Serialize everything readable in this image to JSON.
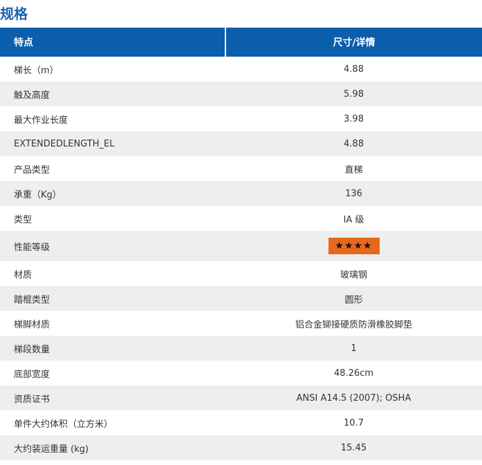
{
  "page": {
    "title": "规格"
  },
  "table": {
    "headers": [
      "特点",
      "尺寸/详情"
    ],
    "rows": [
      {
        "label": "梯长（m）",
        "value": "4.88"
      },
      {
        "label": "触及高度",
        "value": "5.98"
      },
      {
        "label": "最大作业长度",
        "value": "3.98"
      },
      {
        "label": "EXTENDEDLENGTH_EL",
        "value": "4.88"
      },
      {
        "label": "产品类型",
        "value": "直梯"
      },
      {
        "label": "承重（Kg）",
        "value": "136"
      },
      {
        "label": "类型",
        "value": "IA 级"
      },
      {
        "label": "性能等级",
        "value": "★★★★",
        "rating": 4
      },
      {
        "label": "材质",
        "value": "玻璃钢"
      },
      {
        "label": "踏棍类型",
        "value": "圆形"
      },
      {
        "label": "梯脚材质",
        "value": "铝合金铆接硬质防滑橡胶脚垫"
      },
      {
        "label": "梯段数量",
        "value": "1"
      },
      {
        "label": "底部宽度",
        "value": "48.26cm"
      },
      {
        "label": "资质证书",
        "value": "ANSI A14.5 (2007); OSHA"
      },
      {
        "label": "单件大约体积（立方米）",
        "value": "10.7"
      },
      {
        "label": "大约装运重量 (kg)",
        "value": "15.45"
      }
    ]
  },
  "colors": {
    "title": "#1a63b0",
    "header_bg": "#0a5eab",
    "row_alt_bg": "#eeeeee",
    "rating_badge": "#e8681c"
  },
  "icons": {
    "rating": "star-icon"
  }
}
